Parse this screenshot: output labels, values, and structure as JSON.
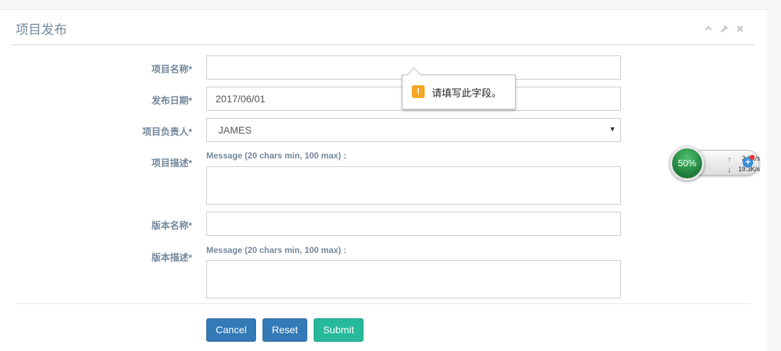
{
  "panel": {
    "title": "项目发布",
    "tools": [
      "chevron-up-icon",
      "wrench-icon",
      "close-icon"
    ]
  },
  "form": {
    "project_name": {
      "label": "项目名称*",
      "value": ""
    },
    "release_date": {
      "label": "发布日期*",
      "value": "2017/06/01"
    },
    "owner": {
      "label": "项目负责人*",
      "value": "JAMES"
    },
    "project_desc": {
      "label": "项目描述*",
      "hint": "Message (20 chars min, 100 max) :",
      "value": ""
    },
    "version_name": {
      "label": "版本名称*",
      "value": ""
    },
    "version_desc": {
      "label": "版本描述*",
      "hint": "Message (20 chars min, 100 max) :",
      "value": ""
    }
  },
  "buttons": {
    "cancel": "Cancel",
    "reset": "Reset",
    "submit": "Submit"
  },
  "tooltip": {
    "icon": "!",
    "text": "请填写此字段。"
  },
  "net_widget": {
    "percent": "50%",
    "up": "2.7K/s",
    "down": "19.3K/s"
  },
  "colors": {
    "primary": "#337ab7",
    "success": "#26b99a",
    "label": "#73879c",
    "warning": "#f5a623"
  }
}
